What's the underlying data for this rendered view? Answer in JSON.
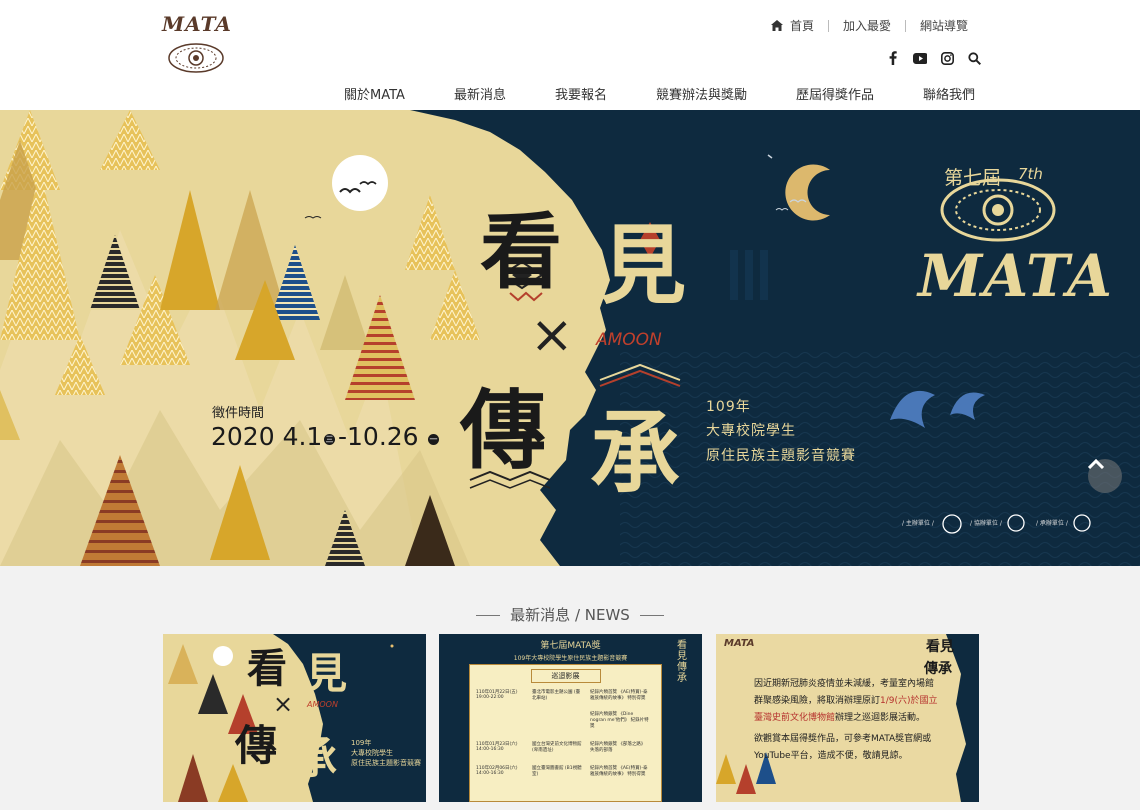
{
  "header": {
    "logo_text": "MATA",
    "top_links": {
      "home": "首頁",
      "favorite": "加入最愛",
      "sitemap": "網站導覽"
    },
    "social_icons": [
      "facebook-icon",
      "youtube-icon",
      "instagram-icon",
      "search-icon"
    ]
  },
  "nav": [
    "關於MATA",
    "最新消息",
    "我要報名",
    "競賽辦法與獎勵",
    "歷屆得獎作品",
    "聯絡我們"
  ],
  "hero": {
    "char_see": "看",
    "char_view": "見",
    "cross": "×",
    "char_pass": "傳",
    "char_inherit": "承",
    "amoon": "AMOON",
    "period_label": "徵件時間",
    "period_date_a": "2020 4.1",
    "period_date_b": "-10.26",
    "day_a": "三",
    "day_b": "一",
    "year": "109年",
    "subtitle_1": "大專校院學生",
    "subtitle_2": "原住民族主題影音競賽",
    "edition_cn": "第七屆",
    "edition_en": "7th",
    "brand": "MATA",
    "org_labels": [
      "/ 主辦單位 /",
      "/ 協辦單位 /",
      "/ 承辦單位 /"
    ]
  },
  "news": {
    "section_title": "最新消息 / NEWS",
    "cards": [
      {
        "char_see": "看",
        "char_view": "見",
        "cross": "×",
        "char_pass": "傳",
        "char_inherit": "承",
        "amoon": "AMOON",
        "line_1": "109年",
        "line_2": "大專校院學生",
        "line_3": "原住民族主題影音競賽"
      },
      {
        "title": "第七屆MATA獎",
        "subtitle": "109年大專校院學生原住民族主題影音競賽",
        "table_header": "巡迴影展",
        "corner": "看見傳承",
        "rows": [
          {
            "date": "110年01月22日(五) 19:00-22:00",
            "place": "臺北市電影主題公園 (臺北車站)",
            "films": "紀錄片類首獎 《AE(特賞)-泰雅族傳統的故事》 特別得獎"
          },
          {
            "date": "",
            "place": "",
            "films": "紀錄片類銀獎 《Dine nogran me'他們》 紀錄片特獎"
          },
          {
            "date": "110年01月23日(六) 14:00-16:30",
            "place": "國立台灣史前文化博物館 (卑南遺址)",
            "films": "紀錄片類銀獎 《部落之路》 失落的部落"
          },
          {
            "date": "110年02月06日(六) 14:00-16:30",
            "place": "國立臺灣圖書館 (B1視聽室)",
            "films": "紀錄片類首獎 《AE(特賞)-泰雅族傳統的故事》 特別得獎"
          }
        ]
      },
      {
        "logo": "MATA",
        "corner_1": "看見",
        "corner_2": "傳承",
        "p1_a": "因近期新冠肺炎疫情並未減緩，考量室內場館",
        "p1_b": "群聚感染風險，將取消辦理原訂",
        "p1_date": "1/9(六)於國立",
        "p1_c": "臺灣史前文化博物館",
        "p1_d": "辦理之巡迴影展活動。",
        "p2_a": "欲觀賞本屆得獎作品，可參考MATA獎官網或",
        "p2_b": "YouTube平台，造成不便，敬請見諒。"
      }
    ]
  },
  "colors": {
    "navy": "#0e2a3f",
    "sand": "#e8d79a",
    "accent_red": "#b5402c",
    "gold": "#d9a21f"
  }
}
